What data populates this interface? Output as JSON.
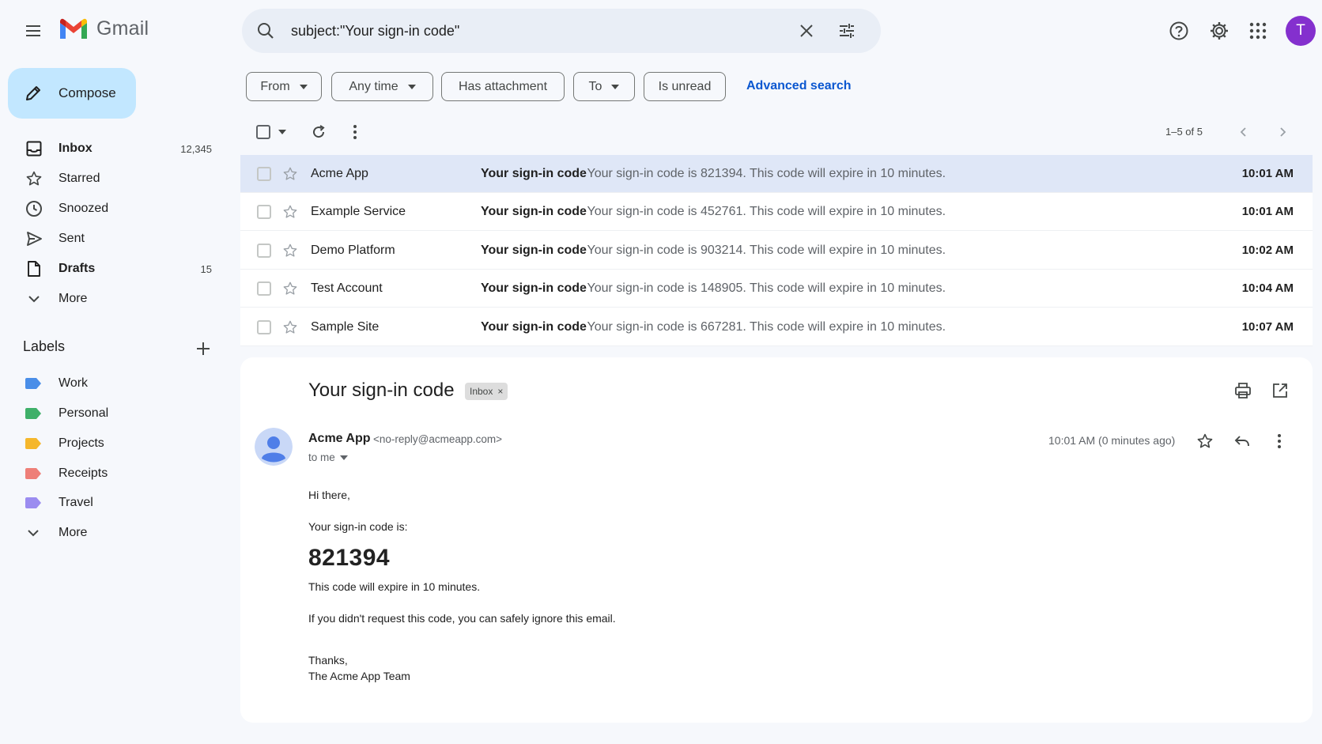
{
  "app": {
    "name": "Gmail",
    "avatar_initial": "T"
  },
  "search": {
    "query": "subject:\"Your sign-in code\""
  },
  "compose": {
    "label": "Compose"
  },
  "nav": {
    "items": [
      {
        "label": "Inbox",
        "count": "12,345",
        "icon": "inbox-icon"
      },
      {
        "label": "Starred",
        "count": "",
        "icon": "star-icon"
      },
      {
        "label": "Snoozed",
        "count": "",
        "icon": "clock-icon"
      },
      {
        "label": "Sent",
        "count": "",
        "icon": "send-icon"
      },
      {
        "label": "Drafts",
        "count": "15",
        "icon": "draft-icon"
      },
      {
        "label": "More",
        "count": "",
        "icon": "chevron-down-icon"
      }
    ]
  },
  "labels": {
    "header": "Labels",
    "items": [
      {
        "name": "Work",
        "color": "#4a8ee8"
      },
      {
        "name": "Personal",
        "color": "#3fb069"
      },
      {
        "name": "Projects",
        "color": "#f5b72c"
      },
      {
        "name": "Receipts",
        "color": "#ee7f78"
      },
      {
        "name": "Travel",
        "color": "#9b8cf0"
      }
    ],
    "more": "More"
  },
  "filters": {
    "chips": [
      "From",
      "Any time",
      "Has attachment",
      "To",
      "Is unread"
    ],
    "advanced": "Advanced search"
  },
  "list": {
    "page_count": "1–5 of 5",
    "rows": [
      {
        "sender": "Acme App",
        "subject": "Your sign-in code",
        "snippet": "- Your sign-in code is 821394. This code will expire in 10 minutes.",
        "time": "10:01 AM",
        "selected": true
      },
      {
        "sender": "Example Service",
        "subject": "Your sign-in code",
        "snippet": "- Your sign-in code is 452761. This code will expire in 10 minutes.",
        "time": "10:01 AM",
        "selected": false
      },
      {
        "sender": "Demo Platform",
        "subject": "Your sign-in code",
        "snippet": "- Your sign-in code is 903214. This code will expire in 10 minutes.",
        "time": "10:02 AM",
        "selected": false
      },
      {
        "sender": "Test Account",
        "subject": "Your sign-in code",
        "snippet": "- Your sign-in code is 148905. This code will expire in 10 minutes.",
        "time": "10:04 AM",
        "selected": false
      },
      {
        "sender": "Sample Site",
        "subject": "Your sign-in code",
        "snippet": "- Your sign-in code is 667281. This code will expire in 10 minutes.",
        "time": "10:07 AM",
        "selected": false
      }
    ]
  },
  "message": {
    "subject": "Your sign-in code",
    "label_chip": "Inbox",
    "sender_name": "Acme App",
    "sender_email": "<no-reply@acmeapp.com>",
    "to": "to me",
    "time": "10:01 AM (0 minutes ago)",
    "greeting": "Hi there,",
    "intro": "Your sign-in code is:",
    "code": "821394",
    "expiry": "This code will expire in 10 minutes.",
    "ignore": "If you didn't request this code, you can safely ignore this email.",
    "thanks": "Thanks,",
    "signature": "The Acme App Team"
  },
  "colors": {
    "accent": "#0b57d0",
    "compose_bg": "#c2e7ff",
    "avatar": "#8430ce",
    "selected_row": "#dfe7f7"
  }
}
